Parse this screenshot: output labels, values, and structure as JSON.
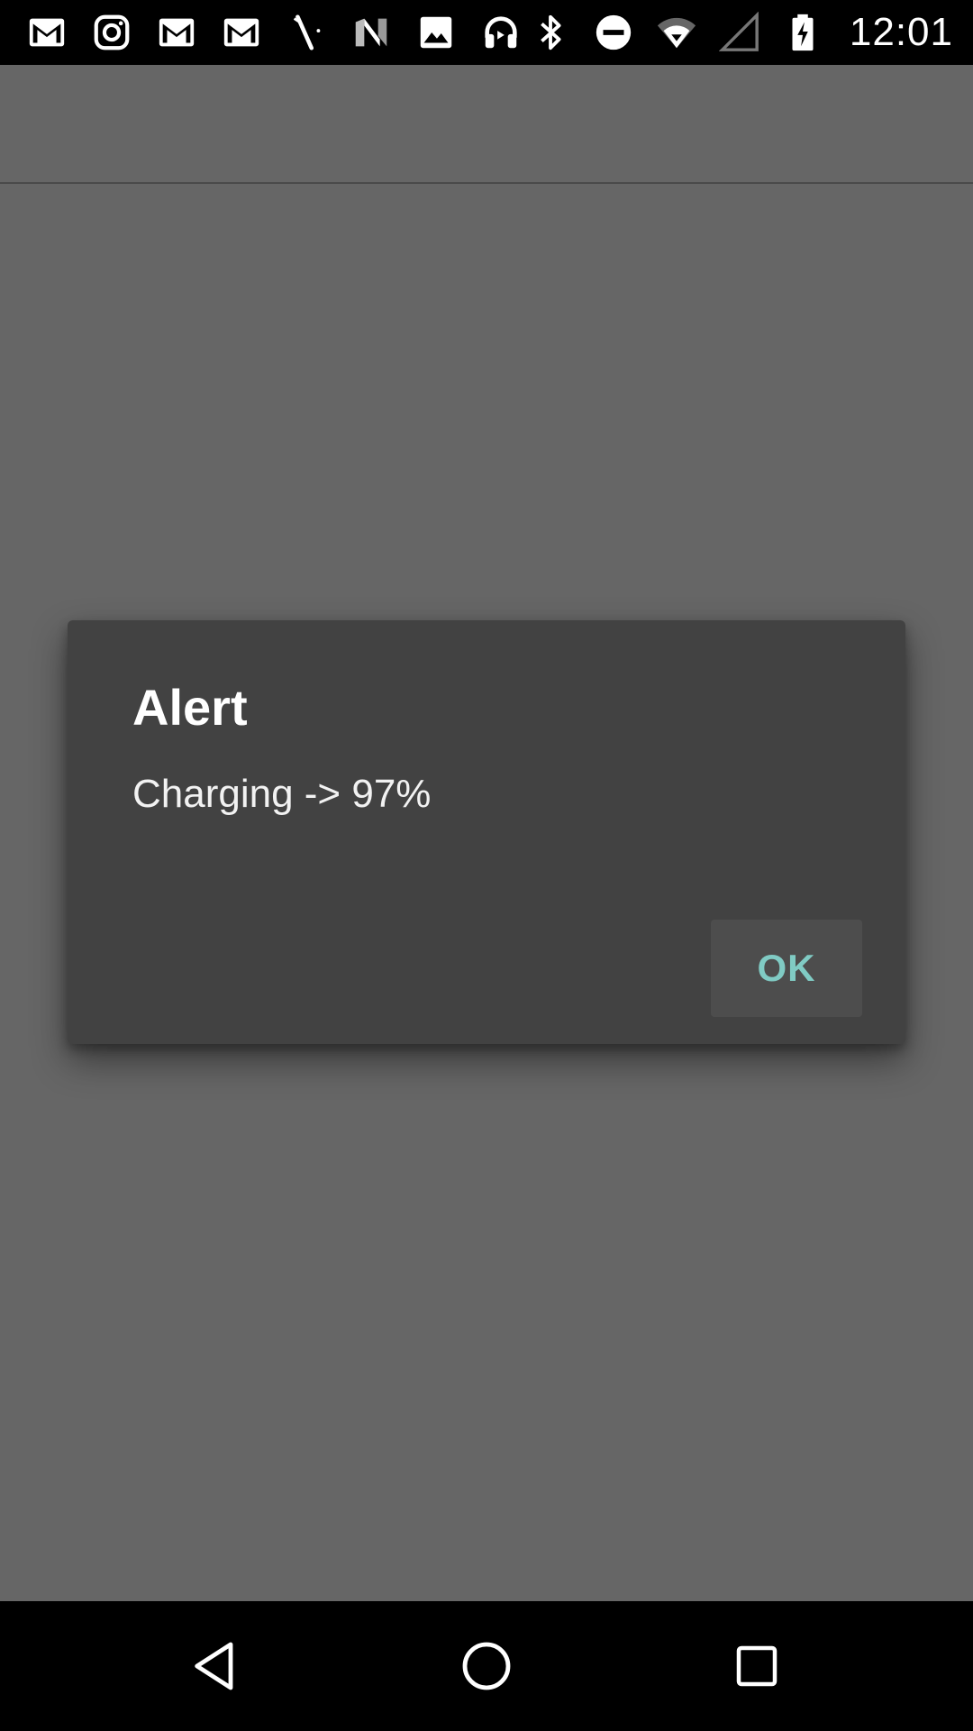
{
  "status_bar": {
    "time": "12:01",
    "left_icons": [
      "gmail-icon",
      "instagram-icon",
      "gmail-icon",
      "gmail-icon",
      "wand-icon",
      "n-logo-icon",
      "image-icon",
      "headphones-icon"
    ],
    "right_icons": [
      "bluetooth-icon",
      "do-not-disturb-icon",
      "wifi-icon",
      "cell-signal-icon",
      "battery-charging-icon"
    ]
  },
  "dialog": {
    "title": "Alert",
    "message": "Charging -> 97%",
    "ok_label": "OK"
  },
  "colors": {
    "scrim": "#666666",
    "dialog_bg": "#424242",
    "accent": "#80cbc4"
  },
  "nav_bar": {
    "buttons": [
      "back-icon",
      "home-icon",
      "recents-icon"
    ]
  }
}
